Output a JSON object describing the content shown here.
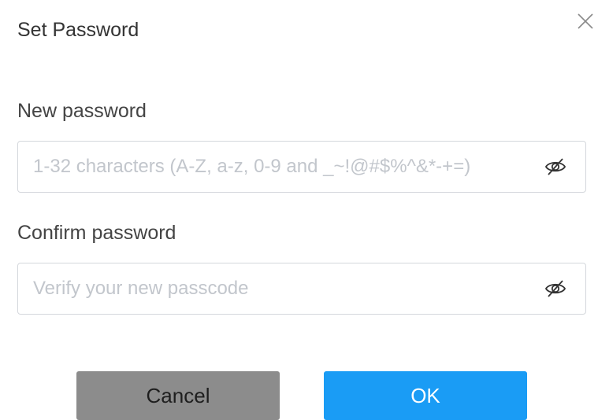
{
  "dialog": {
    "title": "Set Password",
    "close_icon": "close-icon"
  },
  "new_password": {
    "label": "New password",
    "value": "",
    "placeholder": "1-32 characters (A-Z, a-z, 0-9 and _~!@#$%^&*-+=)",
    "toggle_icon": "eye-off-icon"
  },
  "confirm_password": {
    "label": "Confirm password",
    "value": "",
    "placeholder": "Verify your new passcode",
    "toggle_icon": "eye-off-icon"
  },
  "buttons": {
    "cancel_label": "Cancel",
    "ok_label": "OK"
  },
  "colors": {
    "ok_button": "#1a9cf5",
    "cancel_button": "#8c8c8c"
  }
}
